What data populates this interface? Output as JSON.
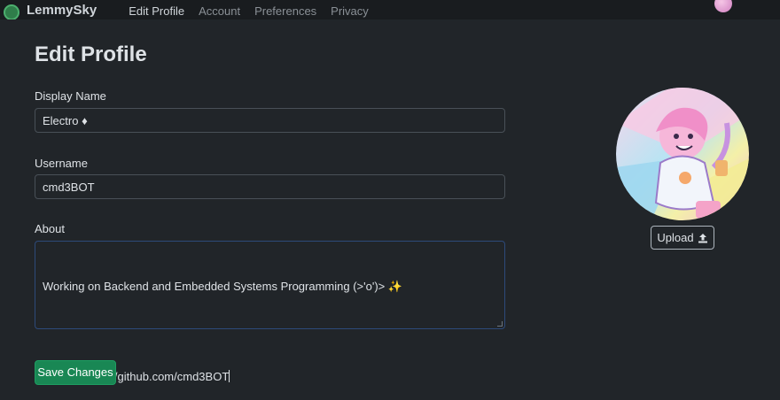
{
  "brand": {
    "name": "LemmySky"
  },
  "nav": {
    "items": [
      {
        "label": "Edit Profile",
        "active": true
      },
      {
        "label": "Account",
        "active": false
      },
      {
        "label": "Preferences",
        "active": false
      },
      {
        "label": "Privacy",
        "active": false
      }
    ]
  },
  "form": {
    "title": "Edit Profile",
    "display_name": {
      "label": "Display Name",
      "value": "Electro ♦"
    },
    "username": {
      "label": "Username",
      "value": "cmd3BOT"
    },
    "about": {
      "label": "About",
      "line1": "Working on Backend and Embedded Systems Programming (>'o')> ✨",
      "line2": "Github: https://github.com/cmd3BOT"
    },
    "save_label": "Save Changes"
  },
  "avatar": {
    "upload_label": "Upload"
  },
  "colors": {
    "background": "#212529",
    "primary_success": "#198754",
    "input_border": "#495057",
    "focus_border": "#2d4a7a"
  },
  "icons": [
    "upload-icon",
    "brand-logo-icon"
  ]
}
